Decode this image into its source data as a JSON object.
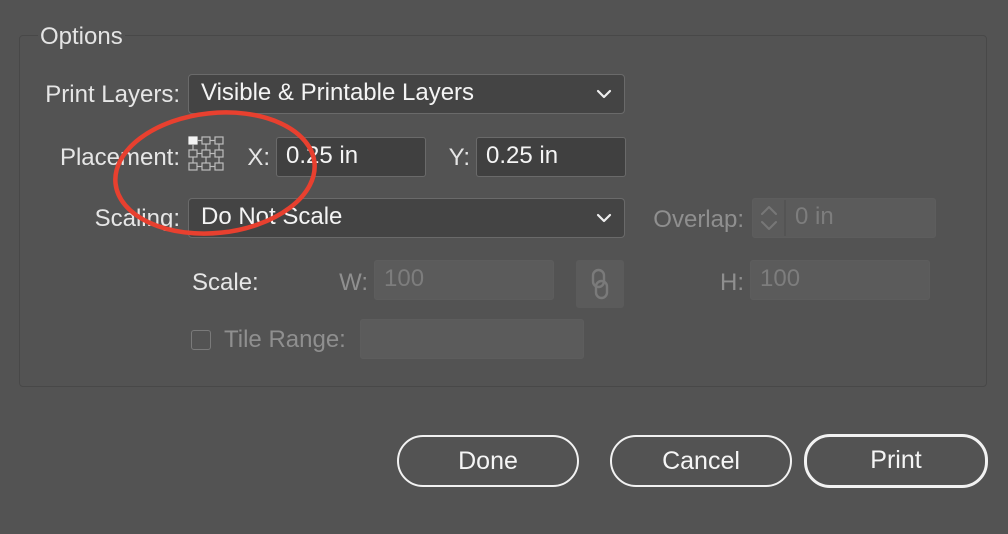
{
  "options": {
    "group_title": "Options",
    "print_layers": {
      "label": "Print Layers:",
      "value": "Visible & Printable Layers"
    },
    "placement": {
      "label": "Placement:",
      "x_label": "X:",
      "x_value": "0.25 in",
      "y_label": "Y:",
      "y_value": "0.25 in"
    },
    "scaling": {
      "label": "Scaling:",
      "value": "Do Not Scale",
      "overlap_label": "Overlap:",
      "overlap_value": "0 in"
    },
    "scale": {
      "label": "Scale:",
      "w_label": "W:",
      "w_value": "100",
      "h_label": "H:",
      "h_value": "100"
    },
    "tile_range": {
      "label": "Tile Range:",
      "value": ""
    }
  },
  "buttons": {
    "done": "Done",
    "cancel": "Cancel",
    "print": "Print"
  },
  "colors": {
    "background": "#535353",
    "annotation": "#e8402f"
  }
}
